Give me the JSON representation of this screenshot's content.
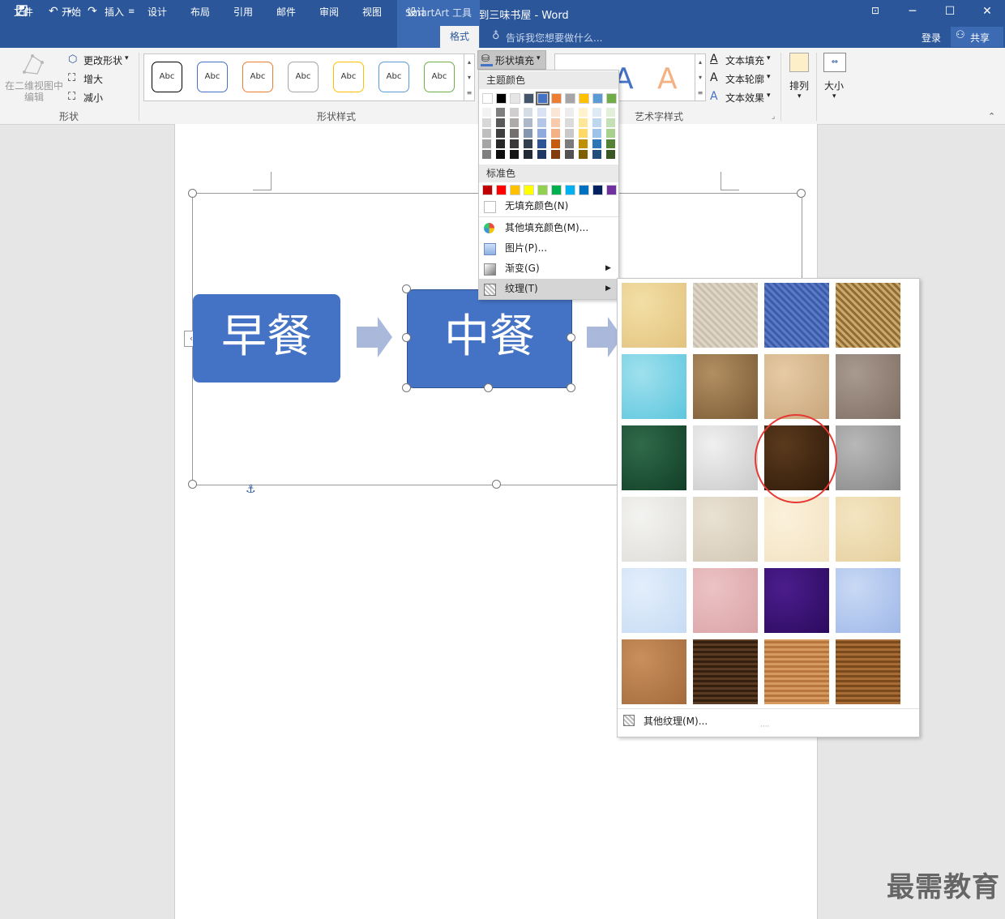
{
  "window": {
    "title": "从百草园到三味书屋 - Word",
    "context_tab_group": "SmartArt 工具"
  },
  "tabs": [
    "文件",
    "开始",
    "插入",
    "设计",
    "布局",
    "引用",
    "邮件",
    "审阅",
    "视图",
    "设计",
    "格式"
  ],
  "tell_me": "告诉我您想要做什么...",
  "account": {
    "login": "登录",
    "share": "共享"
  },
  "ribbon": {
    "shape_group": {
      "edit_2d": "在二维视图中编辑",
      "change_shape": "更改形状",
      "larger": "增大",
      "smaller": "减小",
      "label": "形状"
    },
    "shape_styles": {
      "sample": "Abc",
      "label": "形状样式",
      "swatch_colors": [
        "#000000",
        "#4472c4",
        "#ed7d31",
        "#a5a5a5",
        "#ffc000",
        "#5b9bd5",
        "#70ad47"
      ]
    },
    "shape_fill": "形状填充",
    "wordart": {
      "label": "艺术字样式",
      "text_fill": "文本填充",
      "text_outline": "文本轮廓",
      "text_effects": "文本效果",
      "sample_letter": "A"
    },
    "arrange": "排列",
    "size": "大小"
  },
  "fill_menu": {
    "theme_colors_label": "主题颜色",
    "standard_colors_label": "标准色",
    "theme_top": [
      "#ffffff",
      "#000000",
      "#e7e6e6",
      "#44546a",
      "#4472c4",
      "#ed7d31",
      "#a5a5a5",
      "#ffc000",
      "#5b9bd5",
      "#70ad47"
    ],
    "theme_shades": [
      [
        "#f2f2f2",
        "#d8d8d8",
        "#bfbfbf",
        "#a5a5a5",
        "#7f7f7f"
      ],
      [
        "#7f7f7f",
        "#595959",
        "#3f3f3f",
        "#262626",
        "#0d0d0d"
      ],
      [
        "#d0cece",
        "#aeaaaa",
        "#757070",
        "#3a3838",
        "#171616"
      ],
      [
        "#d6dce4",
        "#adb9ca",
        "#8496b0",
        "#323f4f",
        "#222a35"
      ],
      [
        "#dae3f3",
        "#b4c7e7",
        "#8faadc",
        "#2f5597",
        "#1f3864"
      ],
      [
        "#fbe5d6",
        "#f8cbad",
        "#f4b183",
        "#c55a11",
        "#843c0c"
      ],
      [
        "#ededed",
        "#dbdbdb",
        "#c9c9c9",
        "#7b7b7b",
        "#525252"
      ],
      [
        "#fff2cc",
        "#ffe699",
        "#ffd966",
        "#bf9000",
        "#7f6000"
      ],
      [
        "#deebf7",
        "#bdd7ee",
        "#9dc3e6",
        "#2e75b6",
        "#1f4e79"
      ],
      [
        "#e2f0d9",
        "#c5e0b4",
        "#a9d18e",
        "#548235",
        "#385723"
      ]
    ],
    "standard_colors": [
      "#c00000",
      "#ff0000",
      "#ffc000",
      "#ffff00",
      "#92d050",
      "#00b050",
      "#00b0f0",
      "#0070c0",
      "#002060",
      "#7030a0"
    ],
    "no_fill": "无填充颜色(N)",
    "more_colors": "其他填充颜色(M)...",
    "picture": "图片(P)...",
    "gradient": "渐变(G)",
    "texture": "纹理(T)"
  },
  "texture_panel": {
    "textures": [
      {
        "name": "papyrus",
        "c1": "#f2dfa5",
        "c2": "#e3c27f"
      },
      {
        "name": "canvas",
        "c1": "#ddd6c8",
        "c2": "#c9bfac"
      },
      {
        "name": "denim",
        "c1": "#5a7ac6",
        "c2": "#3b5aa8"
      },
      {
        "name": "woven-mat",
        "c1": "#c9a86a",
        "c2": "#8f6b35"
      },
      {
        "name": "water-droplets",
        "c1": "#9fe0ee",
        "c2": "#5cc6dd"
      },
      {
        "name": "paper-bag",
        "c1": "#b28f62",
        "c2": "#7a5a34"
      },
      {
        "name": "fish-fossil",
        "c1": "#e6cba4",
        "c2": "#c9a57b"
      },
      {
        "name": "sand",
        "c1": "#a99a8f",
        "c2": "#7e6e64"
      },
      {
        "name": "green-marble",
        "c1": "#2f6a4a",
        "c2": "#123e27"
      },
      {
        "name": "white-marble",
        "c1": "#f0f0f0",
        "c2": "#c9c9c9"
      },
      {
        "name": "brown-marble",
        "c1": "#5a3a1c",
        "c2": "#2f1a0a"
      },
      {
        "name": "granite",
        "c1": "#b8b8b8",
        "c2": "#888888"
      },
      {
        "name": "newsprint",
        "c1": "#f3f3f1",
        "c2": "#dedcd7"
      },
      {
        "name": "recycled-paper",
        "c1": "#e9e1d3",
        "c2": "#d3c8b5"
      },
      {
        "name": "parchment",
        "c1": "#fbf1dc",
        "c2": "#f2e2c0"
      },
      {
        "name": "stationery",
        "c1": "#f4e5c2",
        "c2": "#e5cf9c"
      },
      {
        "name": "blue-tissue-paper",
        "c1": "#e3eefb",
        "c2": "#c6dbf4"
      },
      {
        "name": "pink-tissue-paper",
        "c1": "#ecc3c5",
        "c2": "#d9a3a6"
      },
      {
        "name": "purple-mesh",
        "c1": "#4b1d8c",
        "c2": "#2c0a5e"
      },
      {
        "name": "bouquet",
        "c1": "#c9d9f5",
        "c2": "#9fb8e8"
      },
      {
        "name": "cork",
        "c1": "#c98f5c",
        "c2": "#a36a3b"
      },
      {
        "name": "walnut",
        "c1": "#5a3a22",
        "c2": "#33200f"
      },
      {
        "name": "oak",
        "c1": "#d69a5e",
        "c2": "#b6763e"
      },
      {
        "name": "medium-wood",
        "c1": "#a86d37",
        "c2": "#7a4a1d"
      }
    ],
    "more_textures": "其他纹理(M)..."
  },
  "smartart": {
    "nodes": [
      "早餐",
      "中餐"
    ],
    "node_color": "#4472c4",
    "arrow_color": "#a9b8db"
  },
  "watermark": "最需教育"
}
